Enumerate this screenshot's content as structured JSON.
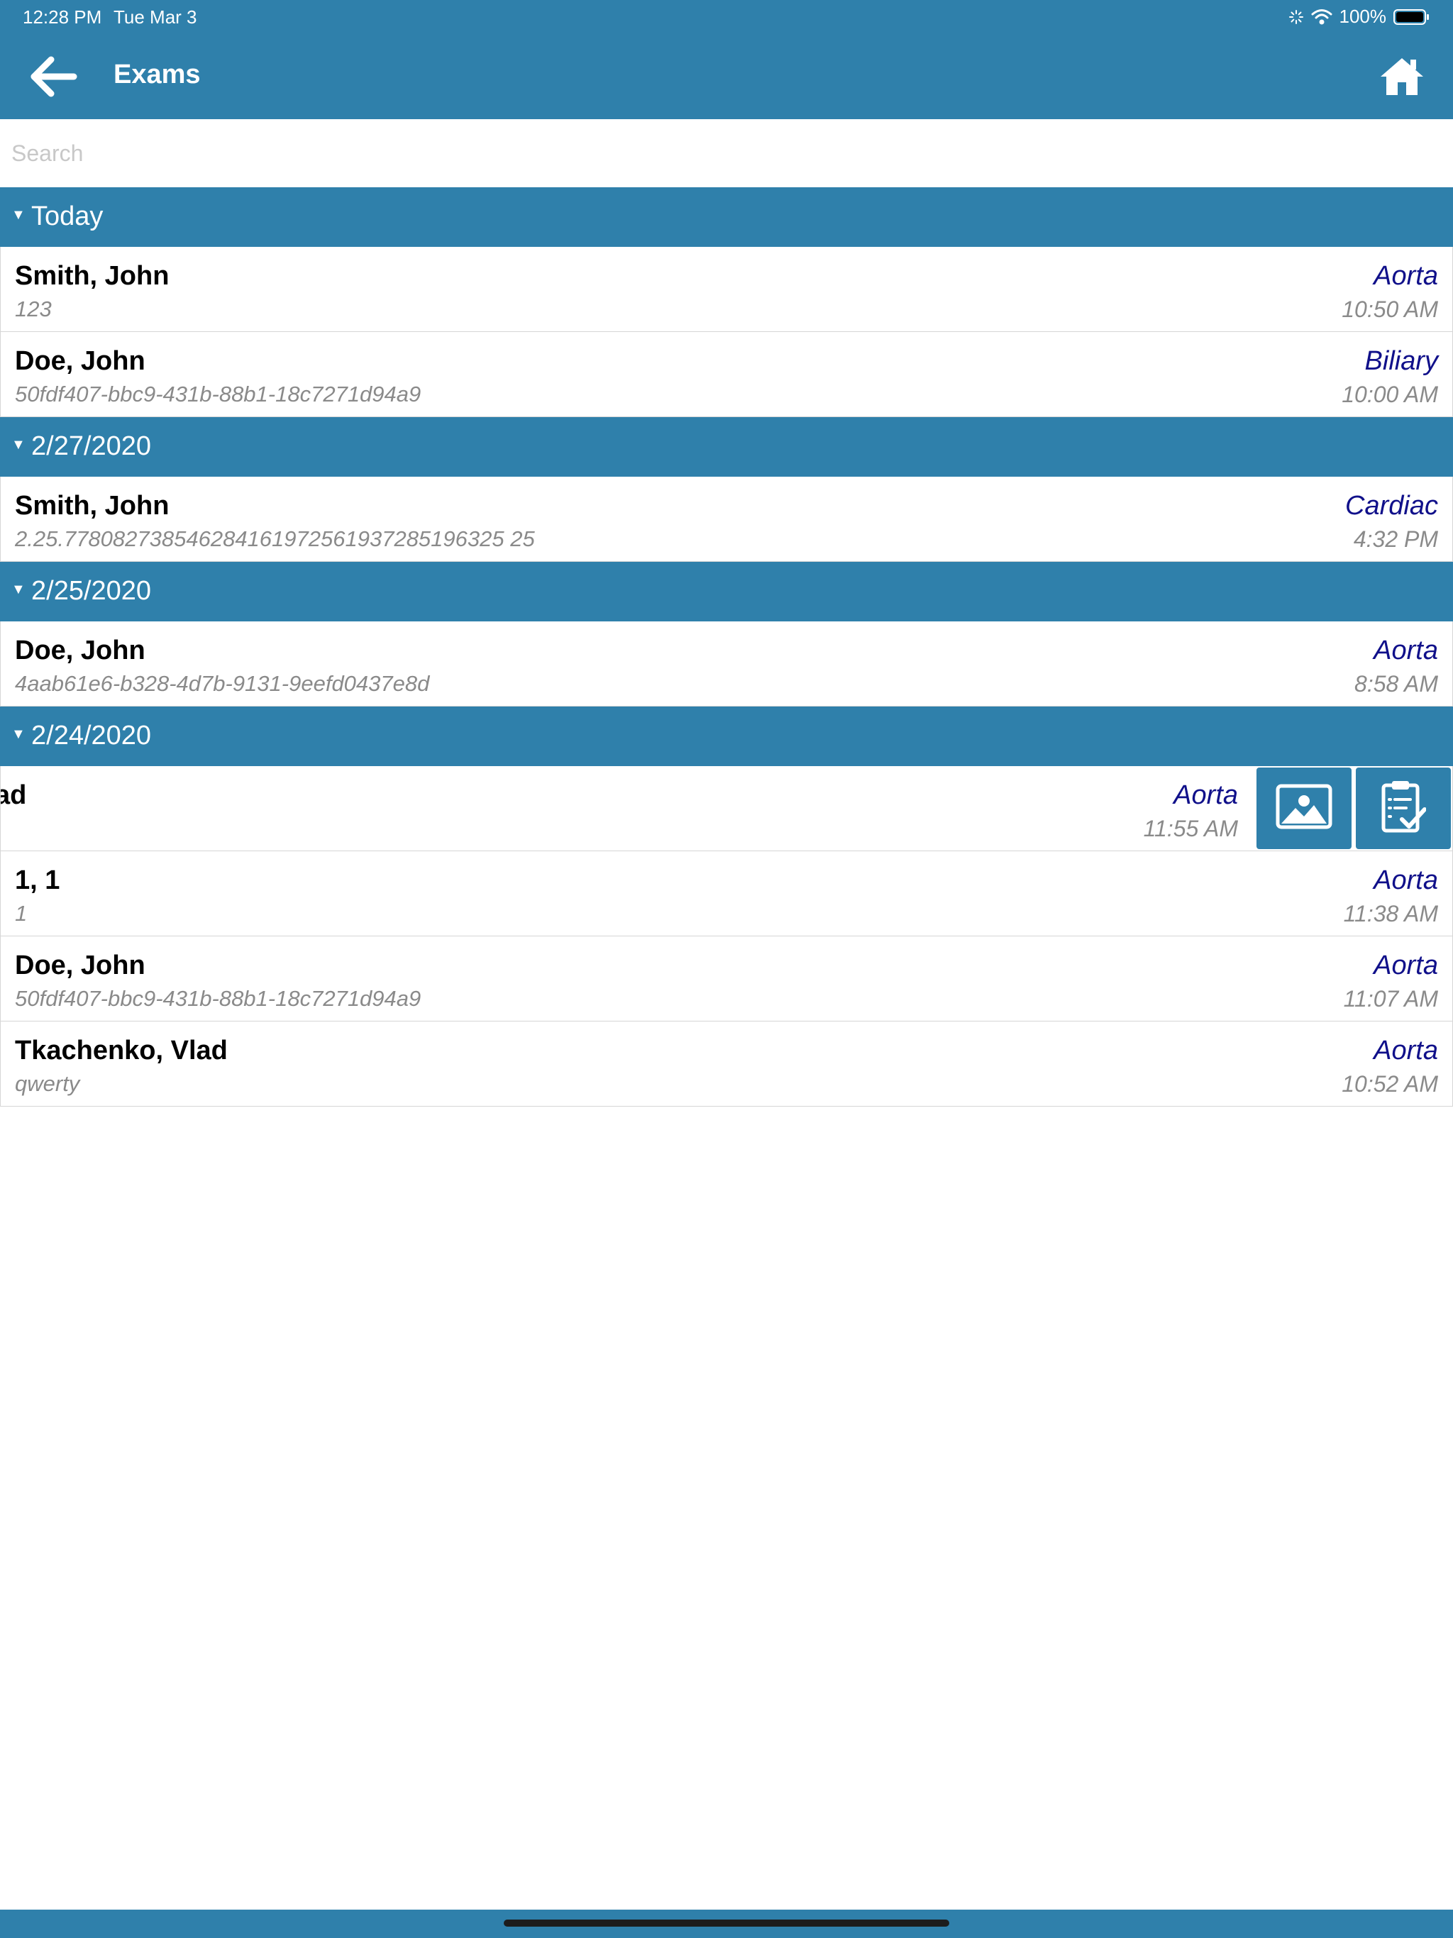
{
  "status_bar": {
    "time": "12:28 PM",
    "date": "Tue Mar 3",
    "battery": "100%"
  },
  "header": {
    "title": "Exams",
    "back_icon": "arrow-left-icon",
    "home_icon": "home-icon"
  },
  "search": {
    "placeholder": "Search",
    "value": ""
  },
  "colors": {
    "accent": "#2f80ab",
    "exam_type": "#10108a",
    "secondary_text": "#8a8a8a"
  },
  "sections": [
    {
      "label": "Today",
      "rows": [
        {
          "name": "Smith, John",
          "sub": "123",
          "type": "Aorta",
          "time": "10:50 AM"
        },
        {
          "name": "Doe, John",
          "sub": "50fdf407-bbc9-431b-88b1-18c7271d94a9",
          "type": "Biliary",
          "time": "10:00 AM"
        }
      ]
    },
    {
      "label": "2/27/2020",
      "rows": [
        {
          "name": "Smith, John",
          "sub": "2.25.778082738546284161972561937285196325 25",
          "type": "Cardiac",
          "time": "4:32 PM"
        }
      ]
    },
    {
      "label": "2/25/2020",
      "rows": [
        {
          "name": "Doe, John",
          "sub": "4aab61e6-b328-4d7b-9131-9eefd0437e8d",
          "type": "Aorta",
          "time": "8:58 AM"
        }
      ]
    },
    {
      "label": "2/24/2020",
      "rows": [
        {
          "name": "ad",
          "sub": "",
          "type": "Aorta",
          "time": "11:55 AM",
          "swiped": true,
          "actions": [
            "image-icon",
            "clipboard-check-icon"
          ]
        },
        {
          "name": "1, 1",
          "sub": "1",
          "type": "Aorta",
          "time": "11:38 AM"
        },
        {
          "name": "Doe, John",
          "sub": "50fdf407-bbc9-431b-88b1-18c7271d94a9",
          "type": "Aorta",
          "time": "11:07 AM"
        },
        {
          "name": "Tkachenko, Vlad",
          "sub": "qwerty",
          "type": "Aorta",
          "time": "10:52 AM"
        }
      ]
    }
  ]
}
